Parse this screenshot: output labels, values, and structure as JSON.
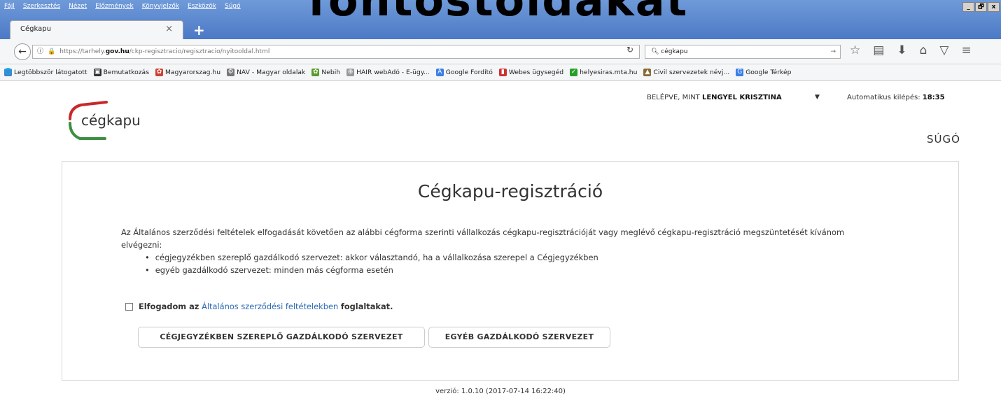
{
  "overlay_text": "fontostoldakat",
  "menu": [
    "Fájl",
    "Szerkesztés",
    "Nézet",
    "Előzmények",
    "Könyvjelzők",
    "Eszközök",
    "Súgó"
  ],
  "window_controls": [
    "_",
    "🗗",
    "x"
  ],
  "tab": {
    "label": "Cégkapu",
    "close": "×",
    "new": "+"
  },
  "url": {
    "prefix": "https://tarhely.",
    "domain": "gov.hu",
    "path": "/ckp-regisztracio/regisztracio/nyitooldal.html"
  },
  "search": {
    "value": "cégkapu"
  },
  "bookmarks": [
    {
      "label": "Legtöbbször látogatott",
      "color": "#4a7fc1",
      "icon": "🌐"
    },
    {
      "label": "Bemutatkozás",
      "color": "#333333",
      "icon": "▣"
    },
    {
      "label": "Magyarorszag.hu",
      "color": "#d04030",
      "icon": "✿"
    },
    {
      "label": "NAV - Magyar oldalak",
      "color": "#777777",
      "icon": "⚙"
    },
    {
      "label": "Nebih",
      "color": "#5a9a2a",
      "icon": "✿"
    },
    {
      "label": "HAIR webAdó - E-ügy...",
      "color": "#999999",
      "icon": "⊕"
    },
    {
      "label": "Google Fordító",
      "color": "#3a7ee8",
      "icon": "A"
    },
    {
      "label": "Webes ügysegéd",
      "color": "#cc3333",
      "icon": "▮"
    },
    {
      "label": "helyesiras.mta.hu",
      "color": "#2a9d2a",
      "icon": "✓"
    },
    {
      "label": "Civil szervezetek névj...",
      "color": "#8a6a30",
      "icon": "▲"
    },
    {
      "label": "Google Térkép",
      "color": "#3a7ee8",
      "icon": "G"
    }
  ],
  "account": {
    "prefix": "BELÉPVE, MINT ",
    "name": "LENGYEL KRISZTINA",
    "auto_prefix": "Automatikus kilépés: ",
    "auto_time": "18:35"
  },
  "logo_text": "cégkapu",
  "help": "SÚGÓ",
  "card": {
    "title": "Cégkapu-regisztráció",
    "intro": "Az Általános szerződési feltételek elfogadását követően az alábbi cégforma szerinti vállalkozás cégkapu-regisztrációját vagy meglévő cégkapu-regisztráció megszüntetését kívánom elvégezni:",
    "bullets": [
      "cégjegyzékben szereplő gazdálkodó szervezet: akkor választandó, ha a vállalkozása szerepel a Cégjegyzékben",
      "egyéb gazdálkodó szervezet: minden más cégforma esetén"
    ],
    "accept_pre": "Elfogadom az",
    "accept_link": "Általános szerződési feltételekben",
    "accept_post": "foglaltakat.",
    "btn_registered": "CÉGJEGYZÉKBEN SZEREPLŐ GAZDÁLKODÓ SZERVEZET",
    "btn_other": "EGYÉB GAZDÁLKODÓ SZERVEZET"
  },
  "version": "verzió: 1.0.10 (2017-07-14 16:22:40)"
}
